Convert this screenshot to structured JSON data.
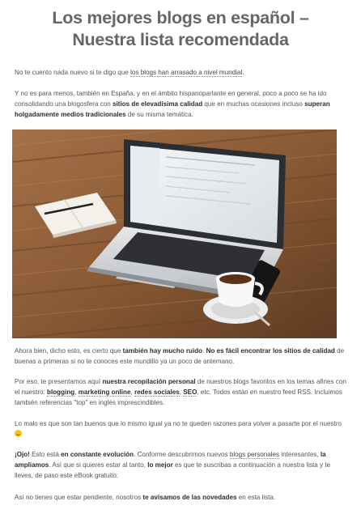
{
  "title_line1": "Los mejores blogs en español –",
  "title_line2": "Nuestra lista recomendada",
  "p1": {
    "t1": "No te cuento nada nuevo si te digo que ",
    "link": "los blogs han arrasado a nivel mundial",
    "t2": "."
  },
  "p2": {
    "t1": "Y no es para menos, también en España, y en el ámbito hispanoparlante en general, poco a poco se ha ido consolidando una blogosfera con ",
    "b1": "sitios de elevadísima calidad",
    "t2": " que en muchas ocasiones incluso ",
    "b2": "superan holgadamente medios tradicionales",
    "t3": " de su misma temática."
  },
  "hero_image_description": "laptop-coffee-notebook-photo",
  "p3": {
    "t1": "Ahora bien, dicho esto, es cierto que ",
    "b1": "también hay mucho ruido",
    "t2": ".  ",
    "b2": "No es fácil encontrar los sitios de calidad",
    "t3": " de buenas a primeras si no te conoces este mundillo ya un poco de antemano."
  },
  "p4": {
    "t1": "Por eso, te presentamos aquí ",
    "b1": "nuestra recopilación personal",
    "t2": " de nuestros blogs favoritos en los temas afines con el nuestro: ",
    "l1": "blogging",
    "s1": ", ",
    "l2": "marketing online",
    "s2": ", ",
    "l3": "redes sociales",
    "s3": ", ",
    "l4": "SEO",
    "t3": ", etc. Todos están en nuestro feed RSS. Incluimos también referencias \"top\" en inglés imprescindibles."
  },
  "p5": {
    "t1": "Lo malo es que son tan buenos que lo mismo igual ya no te queden razones para volver a pasarte por el nuestro "
  },
  "p6": {
    "b1": "¡Ojo!",
    "t1": " Esto está ",
    "b2": "en constante evolución",
    "t2": ". Conforme descubrimos nuevos ",
    "l1": "blogs personales",
    "t3": " interesantes, ",
    "b3": "la ampliamos",
    "t4": ". Así que si quieres estar al tanto, ",
    "b4": "lo mejor",
    "t5": " es que te suscribas a continuación a nuestra lista y te lleves, de paso este eBook gratuito:"
  },
  "p7": {
    "t1": "Así no tienes que estar pendiente, nosotros ",
    "b1": "te avisamos de las novedades",
    "t2": " en esta lista."
  }
}
